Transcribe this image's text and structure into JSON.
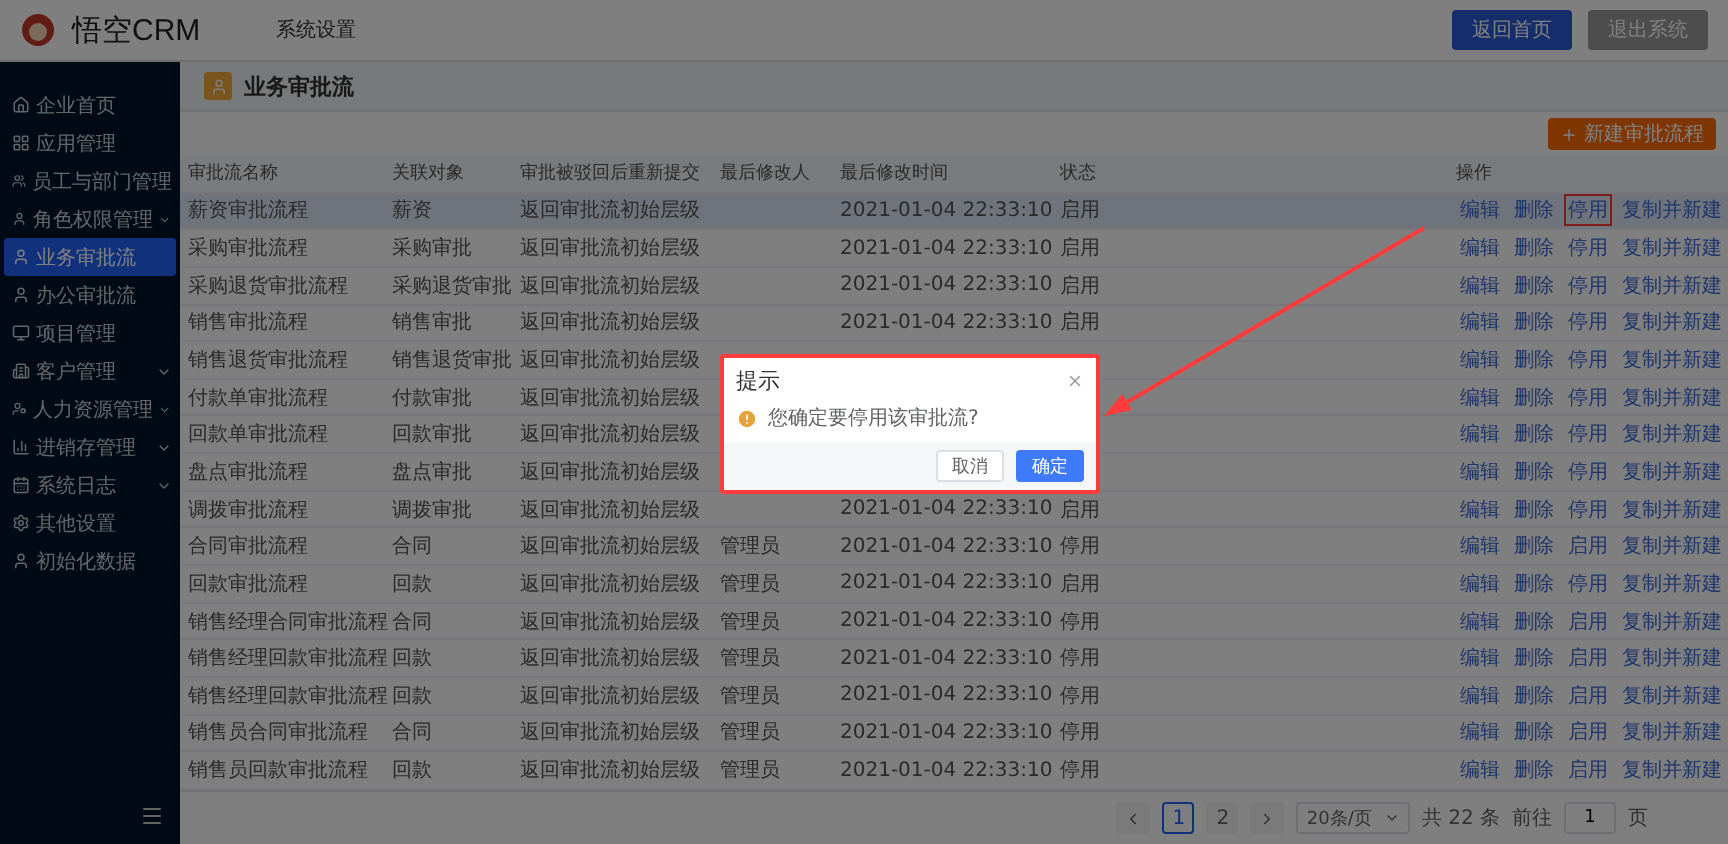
{
  "header": {
    "logo_text": "悟空CRM",
    "nav_title": "系统设置",
    "buttons": [
      {
        "label": "返回首页",
        "kind": "primary"
      },
      {
        "label": "退出系统",
        "kind": "default"
      }
    ]
  },
  "sidebar": {
    "items": [
      {
        "label": "企业首页",
        "expandable": false,
        "selected": false
      },
      {
        "label": "应用管理",
        "expandable": false,
        "selected": false
      },
      {
        "label": "员工与部门管理",
        "expandable": false,
        "selected": false
      },
      {
        "label": "角色权限管理",
        "expandable": true,
        "selected": false
      },
      {
        "label": "业务审批流",
        "expandable": false,
        "selected": true
      },
      {
        "label": "办公审批流",
        "expandable": false,
        "selected": false
      },
      {
        "label": "项目管理",
        "expandable": false,
        "selected": false
      },
      {
        "label": "客户管理",
        "expandable": true,
        "selected": false
      },
      {
        "label": "人力资源管理",
        "expandable": true,
        "selected": false
      },
      {
        "label": "进销存管理",
        "expandable": true,
        "selected": false
      },
      {
        "label": "系统日志",
        "expandable": true,
        "selected": false
      },
      {
        "label": "其他设置",
        "expandable": false,
        "selected": false
      },
      {
        "label": "初始化数据",
        "expandable": false,
        "selected": false
      }
    ]
  },
  "page_title": "业务审批流",
  "new_button": "新建审批流程",
  "table": {
    "columns": [
      "审批流名称",
      "关联对象",
      "审批被驳回后重新提交",
      "最后修改人",
      "最后修改时间",
      "状态",
      "操作"
    ],
    "rows": [
      {
        "selected": true,
        "name": "薪资审批流程",
        "object": "薪资",
        "resubmit": "返回审批流初始层级",
        "time": "2021-01-04 22:33:10",
        "status": "启用",
        "actions": [
          {
            "label": "编辑",
            "highlighted": false
          },
          {
            "label": "删除",
            "highlighted": false
          },
          {
            "label": "停用",
            "highlighted": true
          },
          {
            "label": "复制并新建",
            "highlighted": false
          }
        ]
      },
      {
        "selected": false,
        "name": "采购审批流程",
        "object": "采购审批",
        "resubmit": "返回审批流初始层级",
        "time": "2021-01-04 22:33:10",
        "status": "启用",
        "actions": [
          {
            "label": "编辑",
            "highlighted": false
          },
          {
            "label": "删除",
            "highlighted": false
          },
          {
            "label": "停用",
            "highlighted": false
          },
          {
            "label": "复制并新建",
            "highlighted": false
          }
        ]
      },
      {
        "selected": false,
        "name": "采购退货审批流程",
        "object": "采购退货审批",
        "resubmit": "返回审批流初始层级",
        "time": "2021-01-04 22:33:10",
        "status": "启用",
        "actions": [
          {
            "label": "编辑",
            "highlighted": false
          },
          {
            "label": "删除",
            "highlighted": false
          },
          {
            "label": "停用",
            "highlighted": false
          },
          {
            "label": "复制并新建",
            "highlighted": false
          }
        ]
      },
      {
        "selected": false,
        "name": "销售审批流程",
        "object": "销售审批",
        "resubmit": "返回审批流初始层级",
        "time": "2021-01-04 22:33:10",
        "status": "启用",
        "actions": [
          {
            "label": "编辑",
            "highlighted": false
          },
          {
            "label": "删除",
            "highlighted": false
          },
          {
            "label": "停用",
            "highlighted": false
          },
          {
            "label": "复制并新建",
            "highlighted": false
          }
        ]
      },
      {
        "selected": false,
        "name": "销售退货审批流程",
        "object": "销售退货审批",
        "resubmit": "返回审批流初始层级",
        "actions": [
          {
            "label": "编辑",
            "highlighted": false
          },
          {
            "label": "删除",
            "highlighted": false
          },
          {
            "label": "停用",
            "highlighted": false
          },
          {
            "label": "复制并新建",
            "highlighted": false
          }
        ]
      },
      {
        "selected": false,
        "name": "付款单审批流程",
        "object": "付款审批",
        "resubmit": "返回审批流初始层级",
        "actions": [
          {
            "label": "编辑",
            "highlighted": false
          },
          {
            "label": "删除",
            "highlighted": false
          },
          {
            "label": "停用",
            "highlighted": false
          },
          {
            "label": "复制并新建",
            "highlighted": false
          }
        ]
      },
      {
        "selected": false,
        "name": "回款单审批流程",
        "object": "回款审批",
        "resubmit": "返回审批流初始层级",
        "actions": [
          {
            "label": "编辑",
            "highlighted": false
          },
          {
            "label": "删除",
            "highlighted": false
          },
          {
            "label": "停用",
            "highlighted": false
          },
          {
            "label": "复制并新建",
            "highlighted": false
          }
        ]
      },
      {
        "selected": false,
        "name": "盘点审批流程",
        "object": "盘点审批",
        "resubmit": "返回审批流初始层级",
        "actions": [
          {
            "label": "编辑",
            "highlighted": false
          },
          {
            "label": "删除",
            "highlighted": false
          },
          {
            "label": "停用",
            "highlighted": false
          },
          {
            "label": "复制并新建",
            "highlighted": false
          }
        ]
      },
      {
        "selected": false,
        "name": "调拨审批流程",
        "object": "调拨审批",
        "resubmit": "返回审批流初始层级",
        "time": "2021-01-04 22:33:10",
        "status": "启用",
        "actions": [
          {
            "label": "编辑",
            "highlighted": false
          },
          {
            "label": "删除",
            "highlighted": false
          },
          {
            "label": "停用",
            "highlighted": false
          },
          {
            "label": "复制并新建",
            "highlighted": false
          }
        ]
      },
      {
        "selected": false,
        "name": "合同审批流程",
        "object": "合同",
        "resubmit": "返回审批流初始层级",
        "modifier": "管理员",
        "time": "2021-01-04 22:33:10",
        "status": "停用",
        "actions": [
          {
            "label": "编辑",
            "highlighted": false
          },
          {
            "label": "删除",
            "highlighted": false
          },
          {
            "label": "启用",
            "highlighted": false
          },
          {
            "label": "复制并新建",
            "highlighted": false
          }
        ]
      },
      {
        "selected": false,
        "name": "回款审批流程",
        "object": "回款",
        "resubmit": "返回审批流初始层级",
        "modifier": "管理员",
        "time": "2021-01-04 22:33:10",
        "status": "启用",
        "actions": [
          {
            "label": "编辑",
            "highlighted": false
          },
          {
            "label": "删除",
            "highlighted": false
          },
          {
            "label": "停用",
            "highlighted": false
          },
          {
            "label": "复制并新建",
            "highlighted": false
          }
        ]
      },
      {
        "selected": false,
        "name": "销售经理合同审批流程",
        "object": "合同",
        "resubmit": "返回审批流初始层级",
        "modifier": "管理员",
        "time": "2021-01-04 22:33:10",
        "status": "停用",
        "actions": [
          {
            "label": "编辑",
            "highlighted": false
          },
          {
            "label": "删除",
            "highlighted": false
          },
          {
            "label": "启用",
            "highlighted": false
          },
          {
            "label": "复制并新建",
            "highlighted": false
          }
        ]
      },
      {
        "selected": false,
        "name": "销售经理回款审批流程",
        "object": "回款",
        "resubmit": "返回审批流初始层级",
        "modifier": "管理员",
        "time": "2021-01-04 22:33:10",
        "status": "停用",
        "actions": [
          {
            "label": "编辑",
            "highlighted": false
          },
          {
            "label": "删除",
            "highlighted": false
          },
          {
            "label": "启用",
            "highlighted": false
          },
          {
            "label": "复制并新建",
            "highlighted": false
          }
        ]
      },
      {
        "selected": false,
        "name": "销售经理回款审批流程",
        "object": "回款",
        "resubmit": "返回审批流初始层级",
        "modifier": "管理员",
        "time": "2021-01-04 22:33:10",
        "status": "停用",
        "actions": [
          {
            "label": "编辑",
            "highlighted": false
          },
          {
            "label": "删除",
            "highlighted": false
          },
          {
            "label": "启用",
            "highlighted": false
          },
          {
            "label": "复制并新建",
            "highlighted": false
          }
        ]
      },
      {
        "selected": false,
        "name": "销售员合同审批流程",
        "object": "合同",
        "resubmit": "返回审批流初始层级",
        "modifier": "管理员",
        "time": "2021-01-04 22:33:10",
        "status": "停用",
        "actions": [
          {
            "label": "编辑",
            "highlighted": false
          },
          {
            "label": "删除",
            "highlighted": false
          },
          {
            "label": "启用",
            "highlighted": false
          },
          {
            "label": "复制并新建",
            "highlighted": false
          }
        ]
      },
      {
        "selected": false,
        "name": "销售员回款审批流程",
        "object": "回款",
        "resubmit": "返回审批流初始层级",
        "modifier": "管理员",
        "time": "2021-01-04 22:33:10",
        "status": "停用",
        "actions": [
          {
            "label": "编辑",
            "highlighted": false
          },
          {
            "label": "删除",
            "highlighted": false
          },
          {
            "label": "启用",
            "highlighted": false
          },
          {
            "label": "复制并新建",
            "highlighted": false
          }
        ]
      }
    ]
  },
  "pagination": {
    "pages": [
      {
        "label": "1",
        "selected": true
      },
      {
        "label": "2",
        "selected": false
      }
    ],
    "page_size": "20条/页",
    "total": "共 22 条",
    "goto_label": "前往",
    "goto_value": "1",
    "page_unit": "页"
  },
  "dialog": {
    "title": "提示",
    "message": "您确定要停用该审批流?",
    "highlighted": true,
    "buttons": [
      {
        "label": "取消",
        "kind": "default"
      },
      {
        "label": "确定",
        "kind": "primary"
      }
    ]
  }
}
